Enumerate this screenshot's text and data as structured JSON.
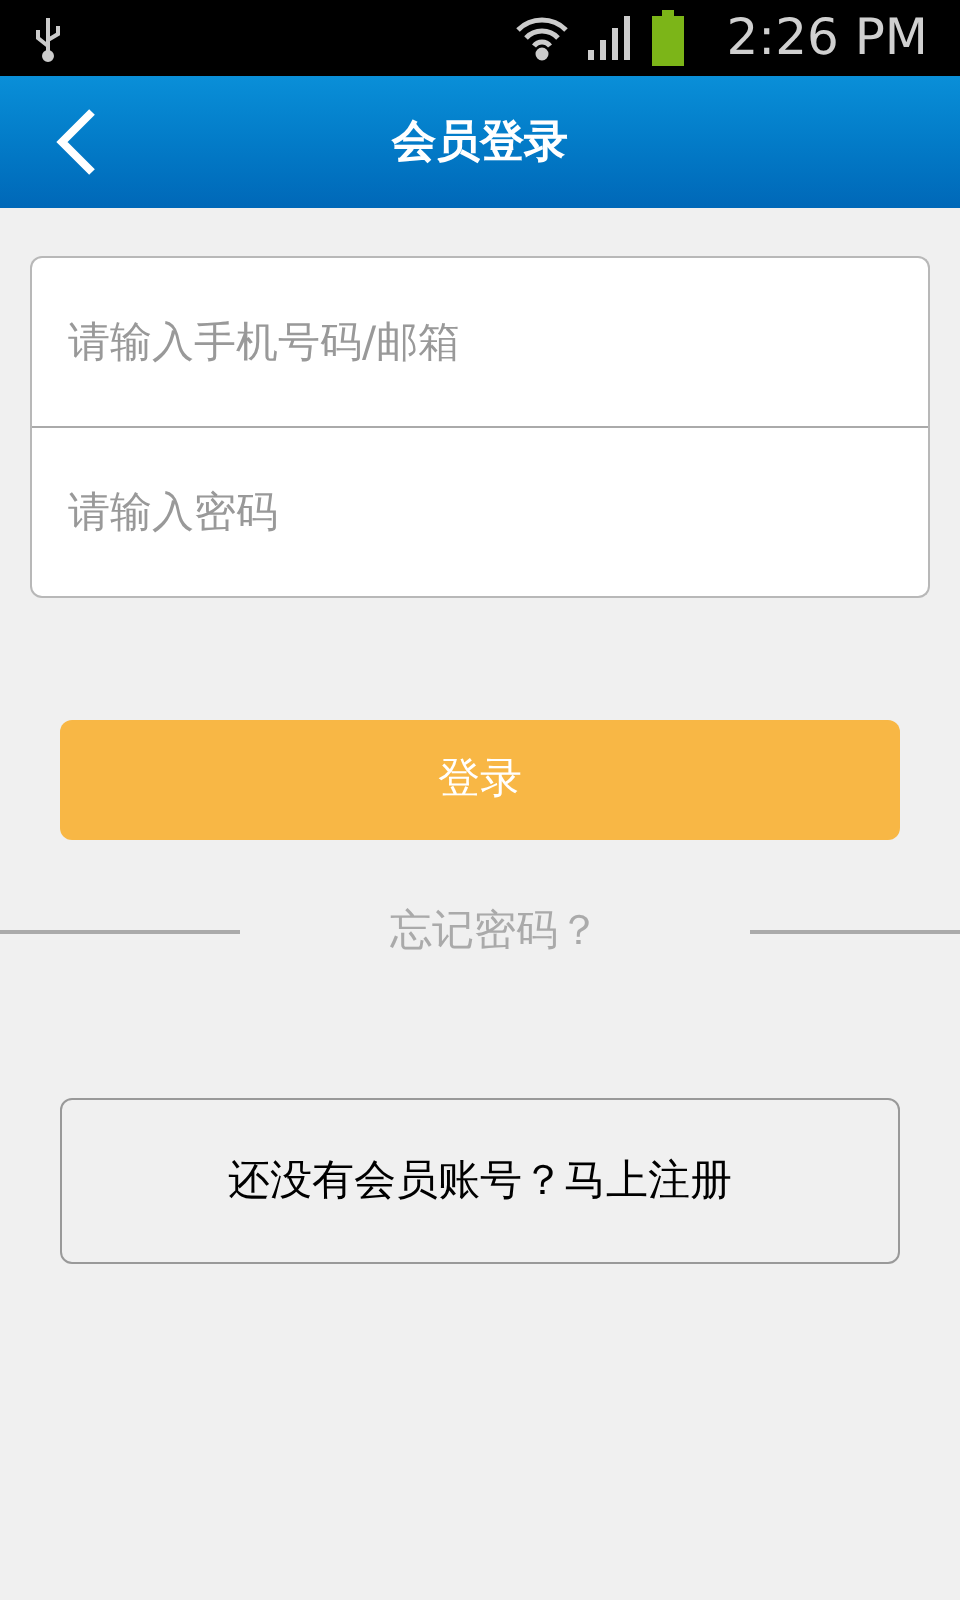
{
  "status_bar": {
    "time": "2:26 PM"
  },
  "header": {
    "title": "会员登录"
  },
  "form": {
    "fields": [
      {
        "placeholder": "请输入手机号码/邮箱"
      },
      {
        "placeholder": "请输入密码"
      }
    ]
  },
  "login_button": "登录",
  "forgot_link": "忘记密码？",
  "register_button": "还没有会员账号？马上注册"
}
